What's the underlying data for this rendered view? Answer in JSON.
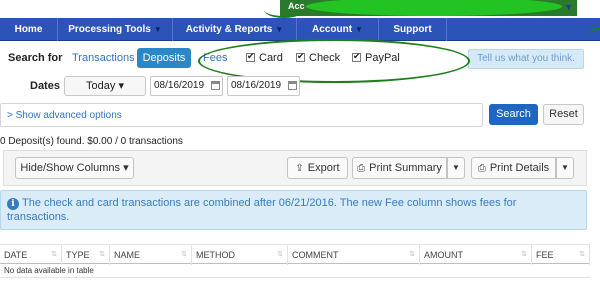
{
  "account_strip": {
    "label": "Acc"
  },
  "nav": {
    "items": [
      {
        "label": "Home",
        "caret": ""
      },
      {
        "label": "Processing Tools",
        "caret": "▼"
      },
      {
        "label": "Activity & Reports",
        "caret": "▼"
      },
      {
        "label": "Account",
        "caret": "▼"
      },
      {
        "label": "Support",
        "caret": ""
      }
    ]
  },
  "search": {
    "label": "Search for",
    "tabs": [
      "Transactions",
      "Deposits",
      "Fees"
    ],
    "active_tab": "Deposits",
    "filters": [
      {
        "label": "Card",
        "checked": true
      },
      {
        "label": "Check",
        "checked": true
      },
      {
        "label": "PayPal",
        "checked": true
      }
    ],
    "feedback_label": "Tell us what you think."
  },
  "dates": {
    "label": "Dates",
    "range_label": "Today ▾",
    "start": "08/16/2019",
    "end": "08/16/2019"
  },
  "advanced": {
    "link_label": "> Show advanced options"
  },
  "actions": {
    "search_label": "Search",
    "reset_label": "Reset"
  },
  "summary": "0 Deposit(s) found. $0.00 / 0 transactions",
  "toolbar": {
    "columns_label": "Hide/Show Columns ▾",
    "export_label": "Export",
    "print_summary_label": "Print Summary",
    "print_details_label": "Print Details"
  },
  "alert": {
    "icon": "i",
    "text": "The check and card transactions are combined after 06/21/2016. The new Fee column shows fees for transactions."
  },
  "table": {
    "columns": [
      "DATE",
      "TYPE",
      "NAME",
      "METHOD",
      "COMMENT",
      "AMOUNT",
      "FEE"
    ],
    "empty_text": "No data available in table"
  },
  "colors": {
    "nav_bg": "#2c54b8",
    "primary_button": "#1f66c1",
    "active_tab": "#2a87c8",
    "annotation": "#1d7f1d",
    "alert_bg": "#d9ecf8"
  }
}
